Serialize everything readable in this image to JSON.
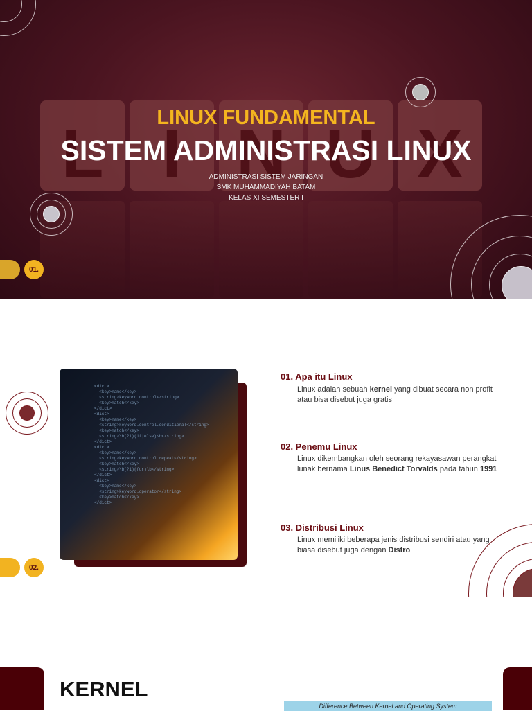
{
  "slide1": {
    "blocks": [
      "L",
      "I",
      "N",
      "U",
      "X"
    ],
    "title_top": "LINUX FUNDAMENTAL",
    "title_main": "SISTEM ADMINISTRASI LINUX",
    "subtitles": [
      "ADMINISTRASI SISTEM JARINGAN",
      "SMK MUHAMMADIYAH BATAM",
      "KELAS XI SEMESTER I"
    ],
    "page_number": "01."
  },
  "slide2": {
    "page_number": "02.",
    "items": [
      {
        "title": "01. Apa itu Linux",
        "pre": "Linux adalah sebuah ",
        "bold": "kernel",
        "post": " yang dibuat secara non profit atau bisa disebut juga gratis"
      },
      {
        "title": "02. Penemu Linux",
        "pre": "Linux dikembangkan oleh seorang rekayasawan perangkat lunak bernama ",
        "bold": "Linus Benedict Torvalds",
        "mid": " pada tahun ",
        "bold2": "1991"
      },
      {
        "title": "03. Distribusi Linux",
        "pre": "Linux memiliki beberapa jenis distribusi sendiri atau yang biasa disebut juga dengan ",
        "bold": "Distro"
      }
    ]
  },
  "slide3": {
    "title": "KERNEL",
    "table_caption": "Difference Between Kernel and Operating System"
  },
  "colors": {
    "maroon": "#4a0a0e",
    "gold": "#f2b321",
    "heading": "#6b0e14"
  }
}
